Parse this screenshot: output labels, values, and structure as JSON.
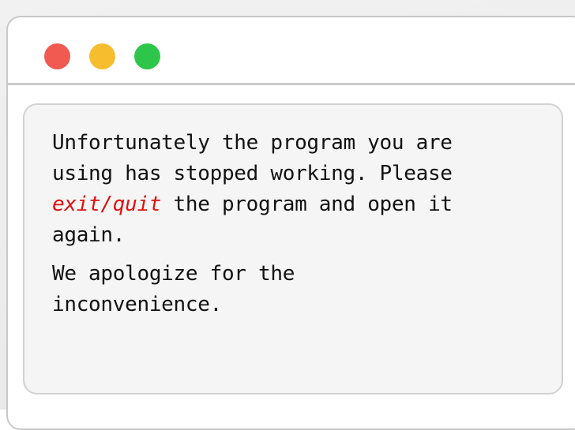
{
  "window": {
    "controls": [
      {
        "name": "close",
        "color": "#f05a51"
      },
      {
        "name": "minimize",
        "color": "#f6bd2f"
      },
      {
        "name": "maximize",
        "color": "#2ec64a"
      }
    ]
  },
  "message": {
    "line1": "Unfortunately the program you are",
    "line2": "using has stopped working. Please",
    "line3_highlight": "exit/quit",
    "line3_rest": " the program and open it",
    "line4": "again.",
    "apology_line1": "We apologize for the",
    "apology_line2": "inconvenience."
  },
  "colors": {
    "highlight": "#e01010"
  }
}
